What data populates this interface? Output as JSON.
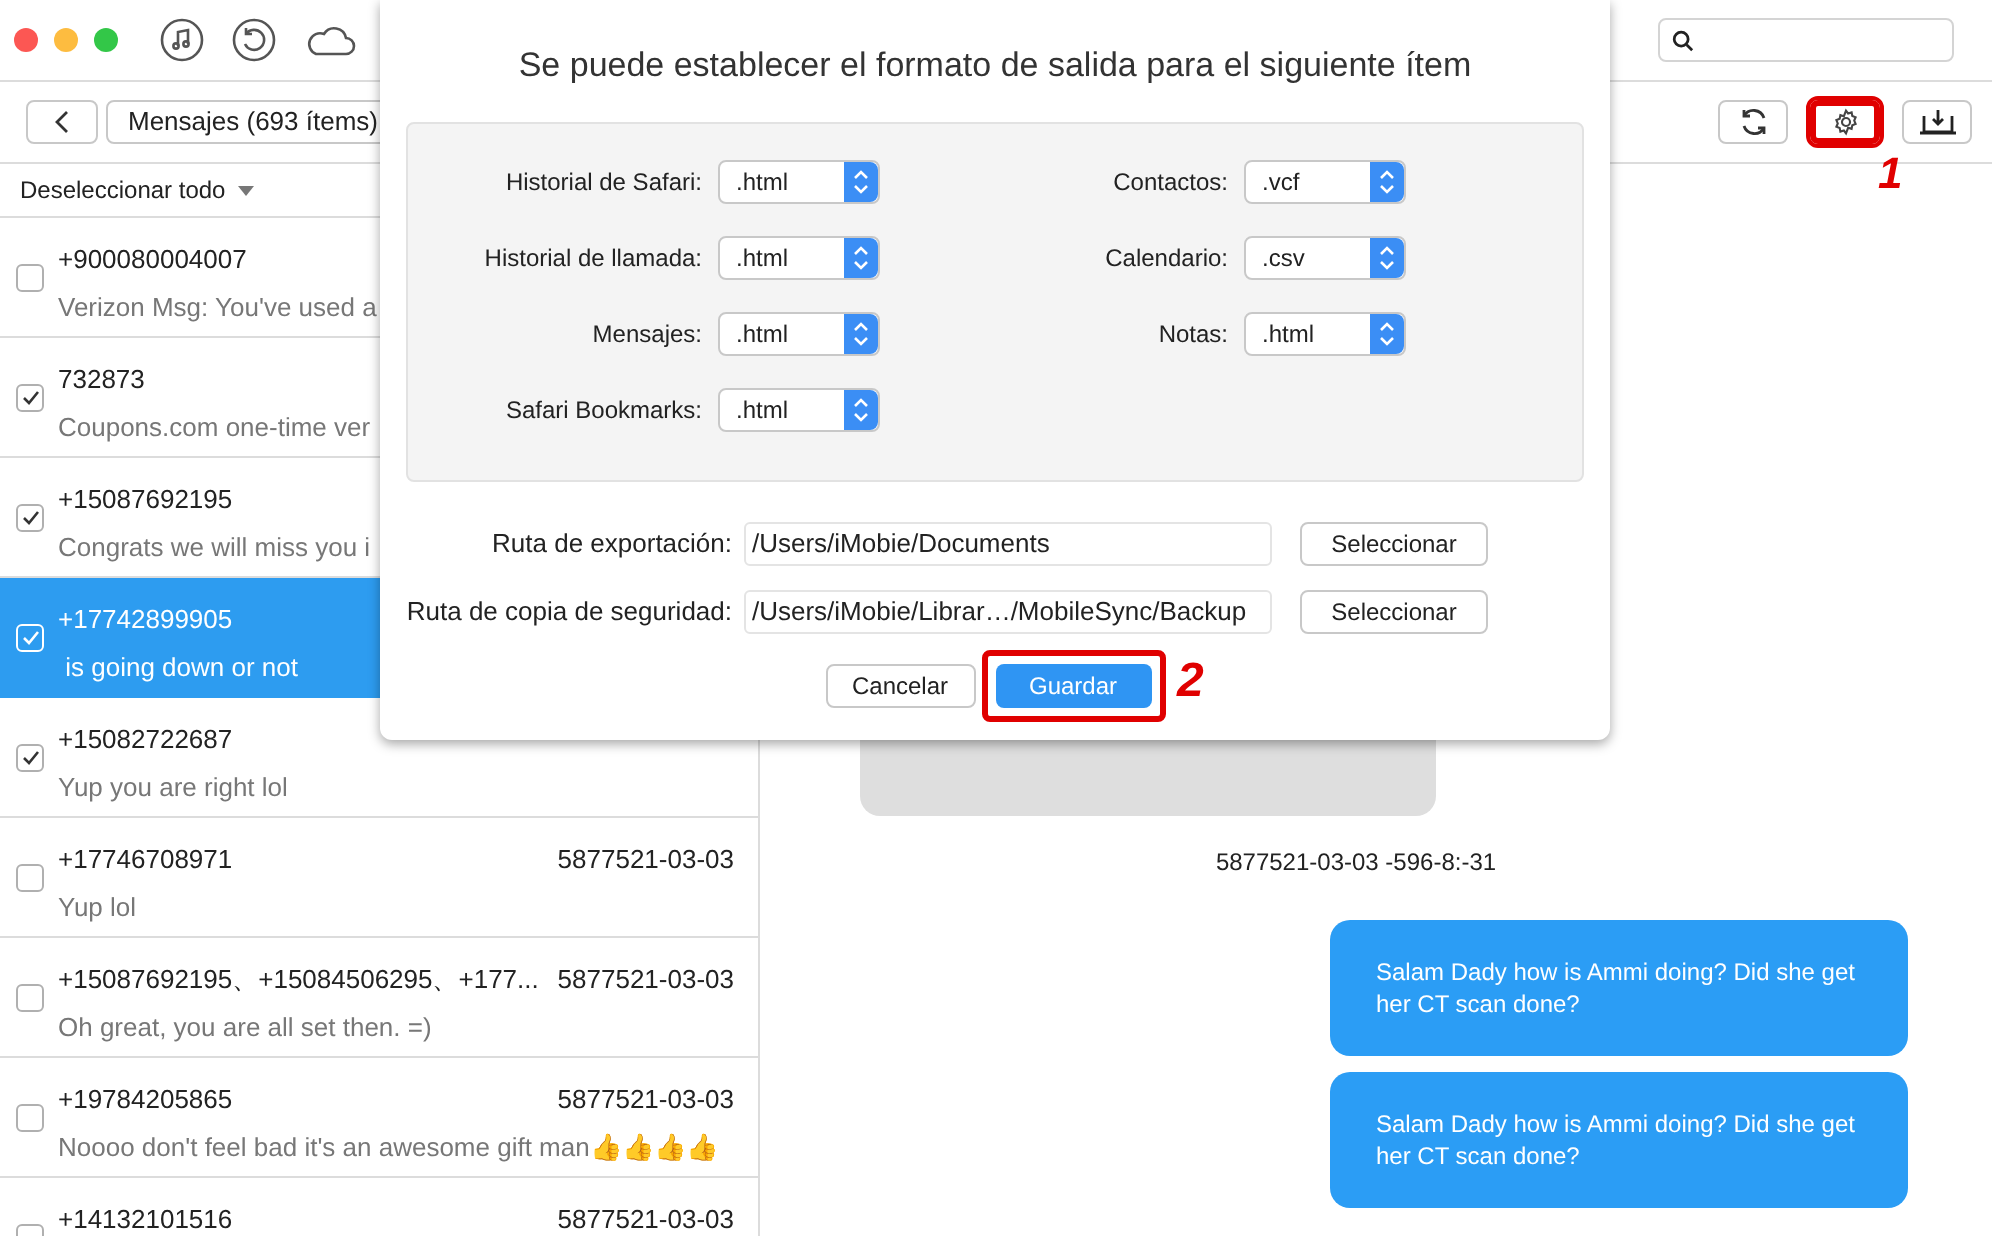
{
  "toolbar": {
    "buttons": [
      {
        "kind": "refresh",
        "highlighted": false
      },
      {
        "kind": "settings",
        "highlighted": true,
        "annotation": "1"
      },
      {
        "kind": "export",
        "highlighted": false
      }
    ]
  },
  "nav": {
    "title": "Mensajes (693 ítems)"
  },
  "select_all": "Deseleccionar todo",
  "conversations": [
    {
      "contact": "+900080004007",
      "preview": "Verizon Msg: You've used a",
      "checked": false,
      "selected": false
    },
    {
      "contact": "732873",
      "preview": "Coupons.com one-time ver",
      "checked": true,
      "selected": false
    },
    {
      "contact": "+15087692195",
      "preview": "Congrats we will miss you i",
      "checked": true,
      "selected": false
    },
    {
      "contact": "+17742899905",
      "preview": " is going down or not",
      "checked": true,
      "selected": true
    },
    {
      "contact": "+15082722687",
      "preview": "Yup you are right lol",
      "checked": true,
      "selected": false
    },
    {
      "contact": "+17746708971",
      "preview": "Yup lol",
      "date": "5877521-03-03",
      "checked": false,
      "selected": false
    },
    {
      "contact": "+15087692195、+15084506295、+177...",
      "preview": "Oh great, you are all set then. =)",
      "date": "5877521-03-03",
      "checked": false,
      "selected": false
    },
    {
      "contact": "+19784205865",
      "preview": "Noooo don't feel bad it's an awesome gift man👍👍👍👍",
      "date": "5877521-03-03",
      "checked": false,
      "selected": false
    },
    {
      "contact": "+14132101516",
      "date": "5877521-03-03",
      "checked": false,
      "selected": false
    }
  ],
  "messages": [
    {
      "kind": "received"
    },
    {
      "kind": "timestamp",
      "text": "5877521-03-03 -596-8:-31"
    },
    {
      "kind": "sent",
      "text": "Salam Dady how is Ammi doing? Did she get her CT scan done?"
    },
    {
      "kind": "sent",
      "text": "Salam Dady how is Ammi doing? Did she get her CT scan done?"
    }
  ],
  "dialog": {
    "title": "Se puede establecer el formato de salida para el siguiente ítem",
    "formats_left": [
      {
        "label": "Historial de Safari:",
        "value": ".html"
      },
      {
        "label": "Historial de llamada:",
        "value": ".html"
      },
      {
        "label": "Mensajes:",
        "value": ".html"
      },
      {
        "label": "Safari Bookmarks:",
        "value": ".html"
      }
    ],
    "formats_right": [
      {
        "label": "Contactos:",
        "value": ".vcf"
      },
      {
        "label": "Calendario:",
        "value": ".csv"
      },
      {
        "label": "Notas:",
        "value": ".html"
      }
    ],
    "paths": [
      {
        "label": "Ruta de exportación:",
        "value": "/Users/iMobie/Documents",
        "button": "Seleccionar"
      },
      {
        "label": "Ruta de copia de seguridad:",
        "value": "/Users/iMobie/Librar…/MobileSync/Backup",
        "button": "Seleccionar"
      }
    ],
    "cancel": "Cancelar",
    "save": {
      "label": "Guardar",
      "highlighted": true,
      "annotation": "2"
    }
  }
}
